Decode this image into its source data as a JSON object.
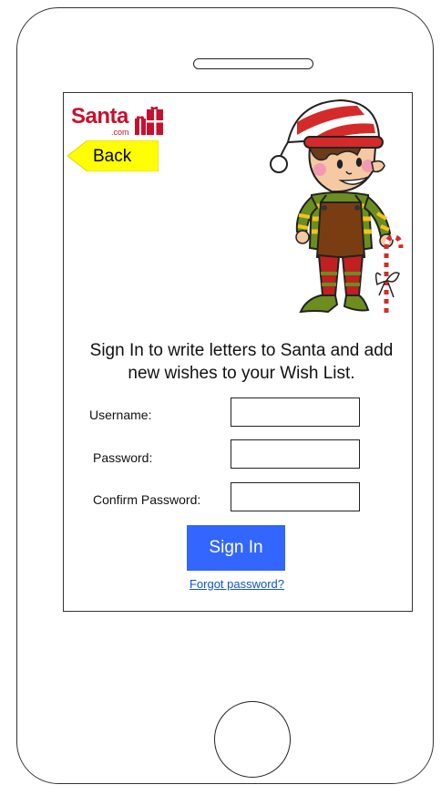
{
  "logo": {
    "brand": "Santa",
    "suffix": ".com"
  },
  "nav": {
    "back_label": "Back"
  },
  "intro": {
    "text": "Sign In to write letters to Santa and add new wishes to your Wish List."
  },
  "form": {
    "username_label": "Username:",
    "username_value": "",
    "password_label": "Password:",
    "password_value": "",
    "confirm_label": "Confirm Password:",
    "confirm_value": ""
  },
  "actions": {
    "signin_label": "Sign In",
    "forgot_label": "Forgot password?"
  },
  "colors": {
    "brand_red": "#c8102e",
    "back_yellow": "#ffff00",
    "primary_blue": "#3366ff",
    "link_blue": "#1155cc"
  },
  "icons": {
    "back": "arrow-left-tab-icon",
    "logo_gifts": "gift-boxes-icon",
    "mascot": "elf-illustration"
  }
}
